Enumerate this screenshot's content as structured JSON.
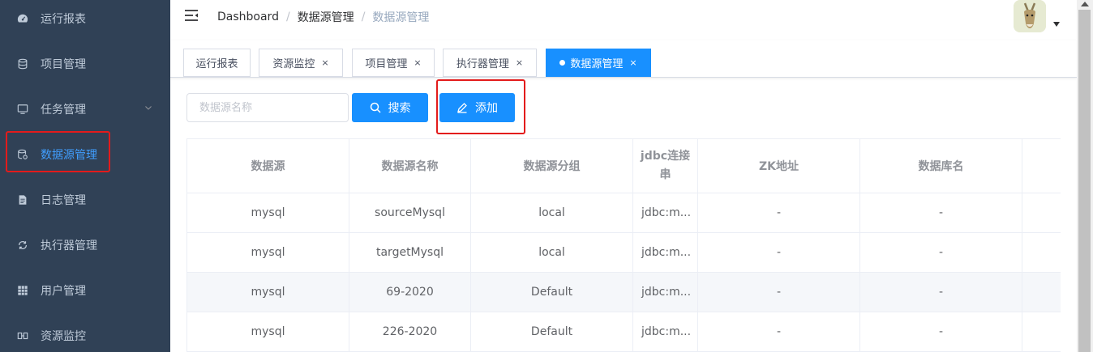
{
  "sidebar": {
    "items": [
      {
        "label": "运行报表",
        "icon": "dashboard-icon"
      },
      {
        "label": "项目管理",
        "icon": "database-icon"
      },
      {
        "label": "任务管理",
        "icon": "monitor-icon"
      },
      {
        "label": "数据源管理",
        "icon": "datasource-icon"
      },
      {
        "label": "日志管理",
        "icon": "document-icon"
      },
      {
        "label": "执行器管理",
        "icon": "executor-icon"
      },
      {
        "label": "用户管理",
        "icon": "users-grid-icon"
      },
      {
        "label": "资源监控",
        "icon": "resource-icon"
      }
    ]
  },
  "navbar": {
    "breadcrumb": [
      "Dashboard",
      "数据源管理",
      "数据源管理"
    ],
    "separator": "/"
  },
  "tags": {
    "items": [
      {
        "label": "运行报表",
        "closable": false
      },
      {
        "label": "资源监控",
        "closable": true
      },
      {
        "label": "项目管理",
        "closable": true
      },
      {
        "label": "执行器管理",
        "closable": true
      },
      {
        "label": "数据源管理",
        "closable": true,
        "active": true
      }
    ],
    "close_glyph": "×"
  },
  "toolbar": {
    "search_placeholder": "数据源名称",
    "search_value": "",
    "search_button": "搜索",
    "add_button": "添加"
  },
  "table": {
    "headers": [
      "数据源",
      "数据源名称",
      "数据源分组",
      "jdbc连接串",
      "ZK地址",
      "数据库名",
      ""
    ],
    "rows": [
      [
        "mysql",
        "sourceMysql",
        "local",
        "jdbc:m...",
        "-",
        "-",
        ""
      ],
      [
        "mysql",
        "targetMysql",
        "local",
        "jdbc:m...",
        "-",
        "-",
        ""
      ],
      [
        "mysql",
        "69-2020",
        "Default",
        "jdbc:m...",
        "-",
        "-",
        ""
      ],
      [
        "mysql",
        "226-2020",
        "Default",
        "jdbc:m...",
        "-",
        "-",
        ""
      ]
    ]
  },
  "colors": {
    "sidebar_bg": "#304156",
    "sidebar_text": "#bfcbd9",
    "accent": "#1890ff",
    "highlight_box": "#e31b1b"
  }
}
